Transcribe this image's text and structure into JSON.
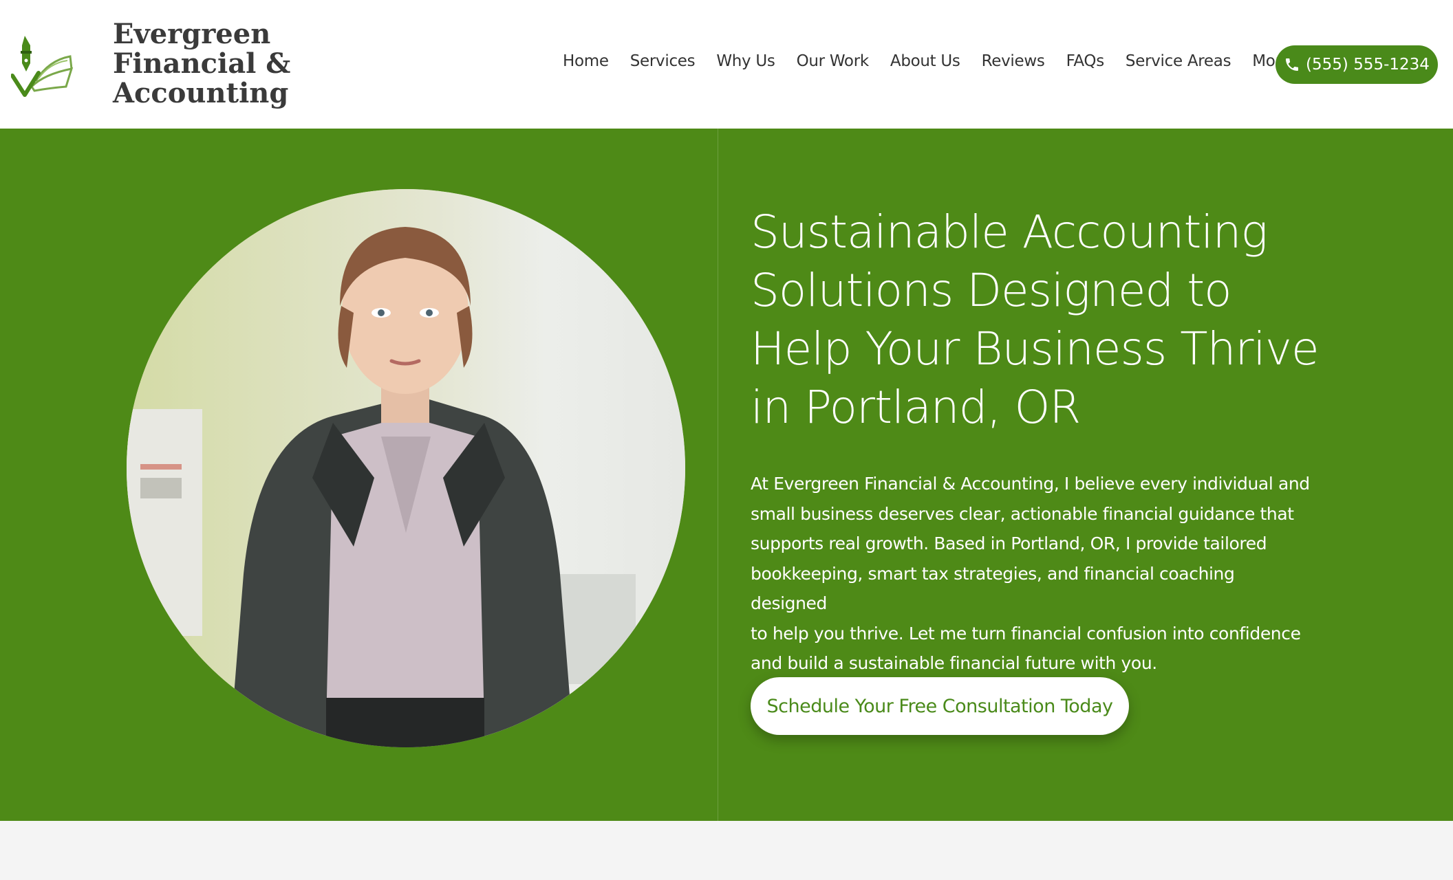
{
  "brand": {
    "name_line1": "Evergreen",
    "name_line2": "Financial &",
    "name_line3": "Accounting",
    "accent_color": "#4a8a1a",
    "hero_bg": "#4e8a17",
    "logo_icon": "pen-book-check-icon"
  },
  "nav": {
    "items": [
      "Home",
      "Services",
      "Why Us",
      "Our Work",
      "About Us",
      "Reviews",
      "FAQs",
      "Service Areas",
      "More"
    ]
  },
  "phone": {
    "icon": "phone-icon",
    "label": "(555) 555-1234"
  },
  "hero": {
    "headline_line1": "Sustainable Accounting",
    "headline_line2": "Solutions  Designed to",
    "headline_line3": "Help Your  Business Thrive",
    "headline_line4": "in  Portland, OR",
    "paragraph_line1": "At  Evergreen  Financial & Accounting,  I believe every individual and",
    "paragraph_line2": "small business deserves clear, actionable financial guidance that",
    "paragraph_line3": "supports real growth.  Based in  Portland, OR,  I provide tailored",
    "paragraph_line4": "bookkeeping, smart tax strategies, and financial coaching designed",
    "paragraph_line5": "to help you thrive.  Let me turn financial confusion into confidence",
    "paragraph_line6": "and build a sustainable financial future with you.",
    "cta_label": "Schedule Your  Free Consultation Today"
  }
}
